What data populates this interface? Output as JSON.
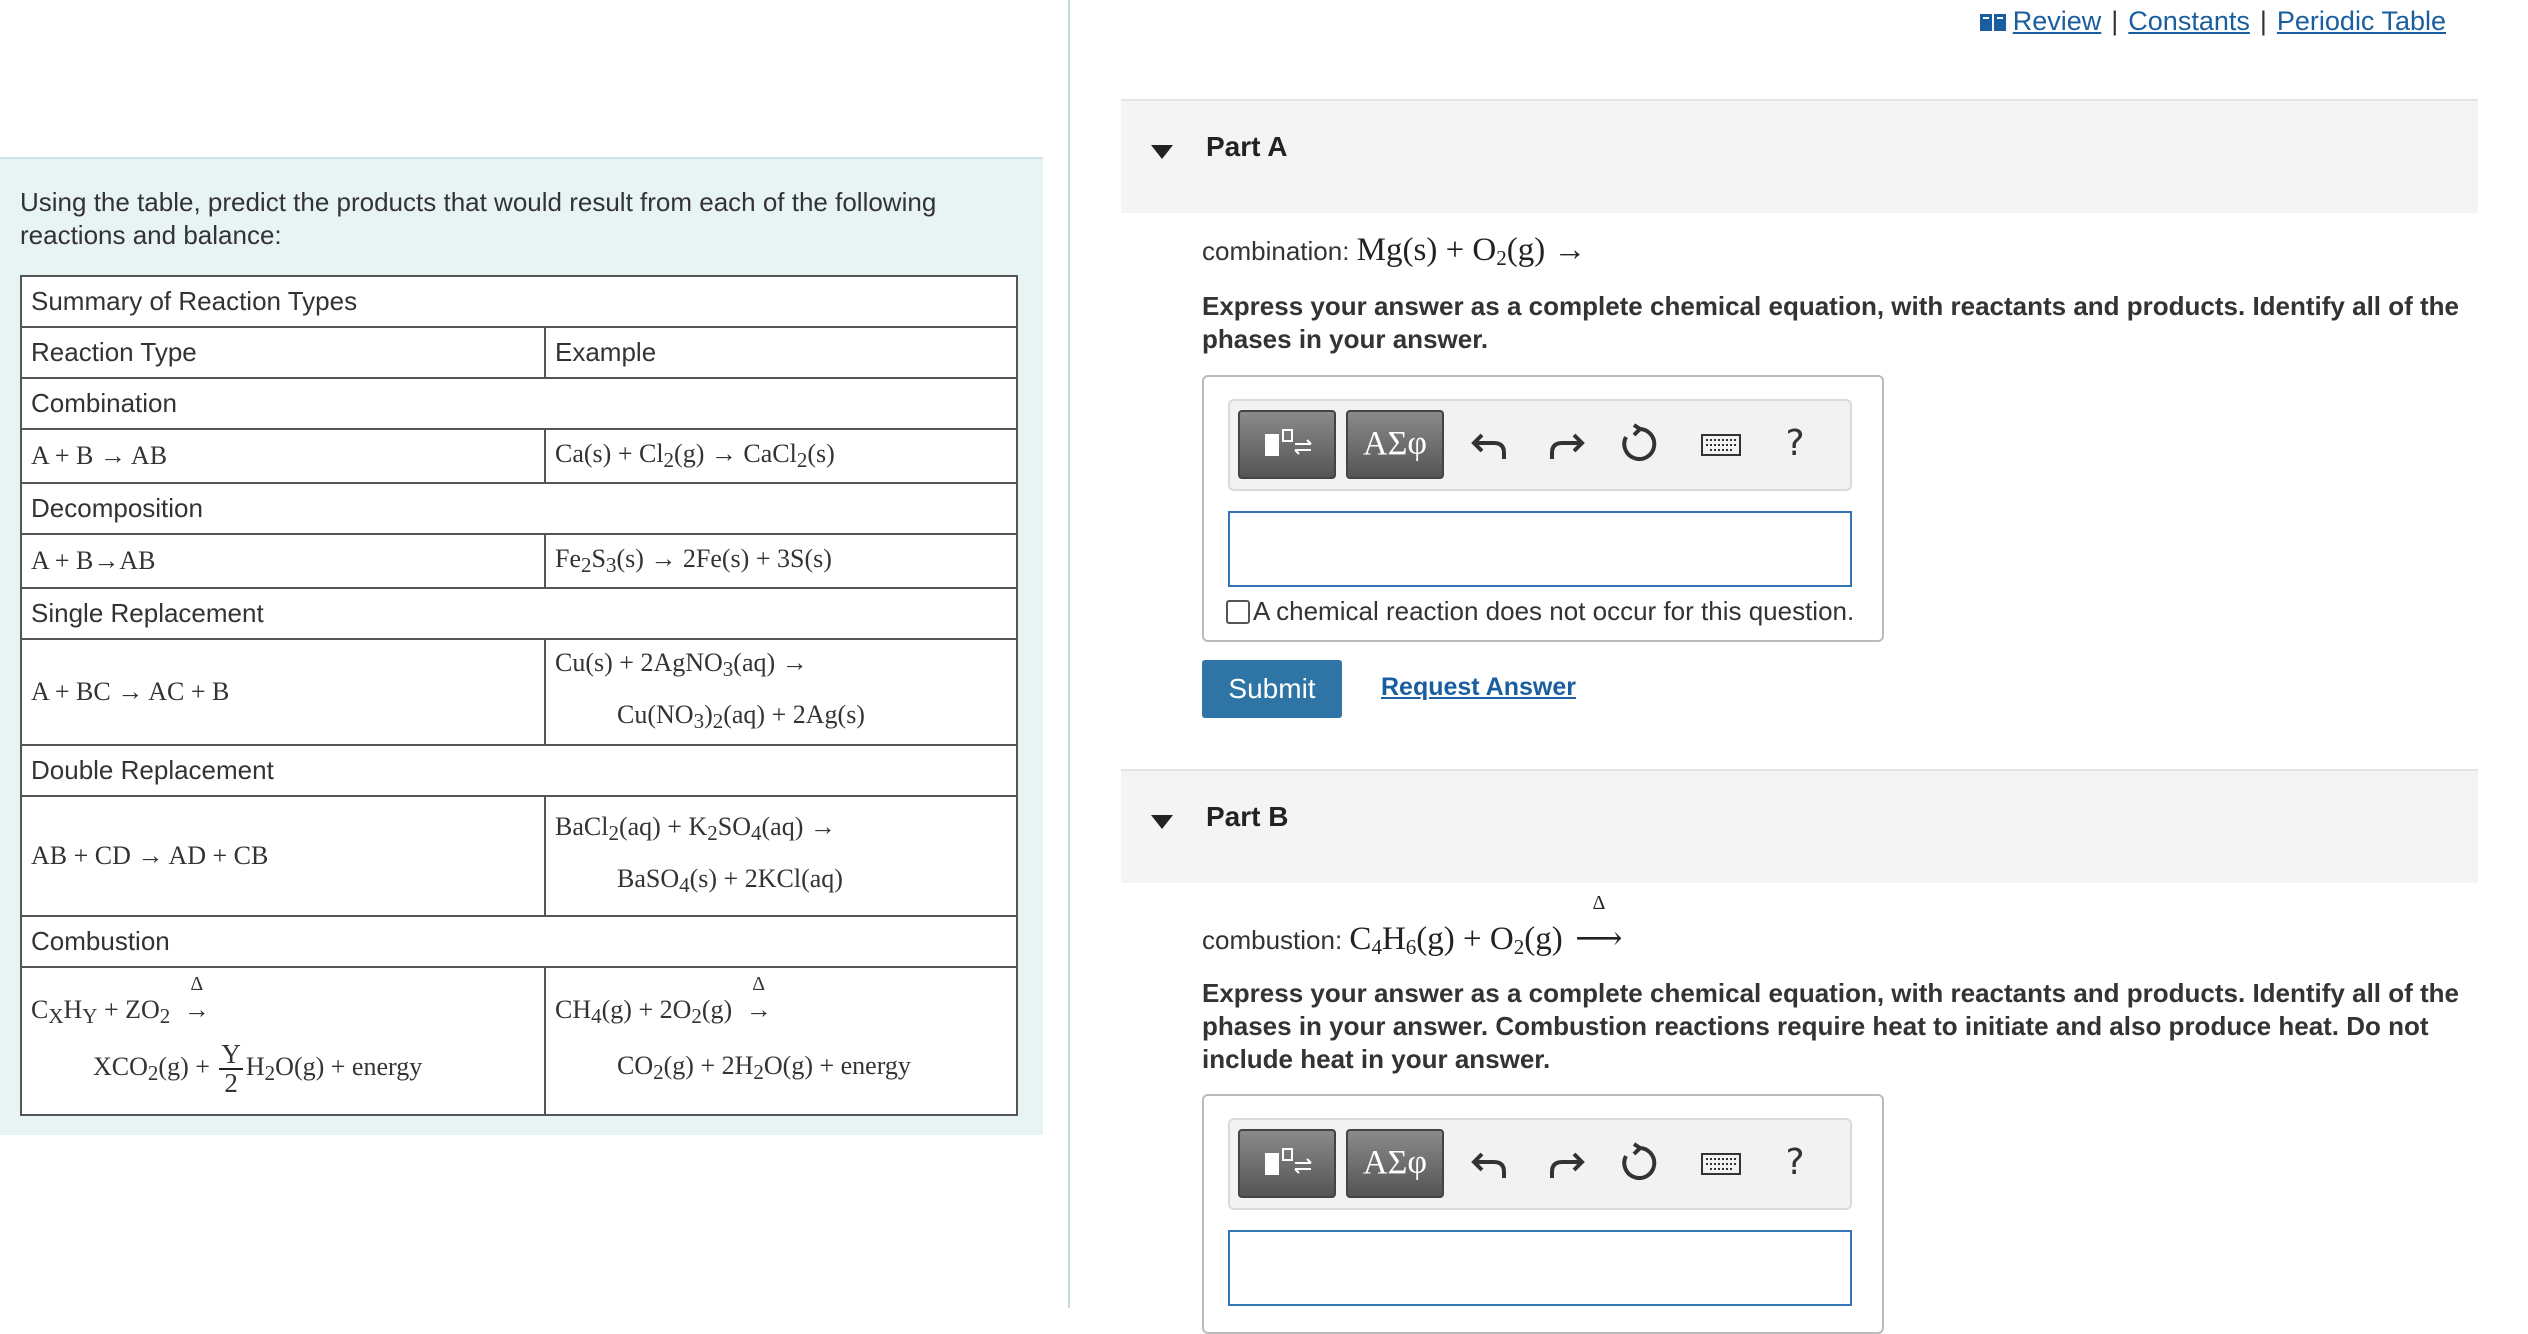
{
  "intro": {
    "text": "Using the table, predict the products that would result from each of the following reactions and balance:"
  },
  "table": {
    "caption": "Summary of Reaction Types",
    "col_reaction_type": "Reaction Type",
    "col_example": "Example",
    "sections": [
      {
        "name": "Combination"
      },
      {
        "name": "Decomposition"
      },
      {
        "name": "Single Replacement"
      },
      {
        "name": "Double Replacement"
      },
      {
        "name": "Combustion"
      }
    ]
  },
  "top_links": {
    "review": "Review",
    "constants": "Constants",
    "periodic_table": "Periodic Table",
    "separator": "|"
  },
  "part_a": {
    "title": "Part A",
    "question_prefix": "combination:",
    "instructions": "Express your answer as a complete chemical equation, with reactants and products. Identify all of the phases in your answer.",
    "no_reaction_label": "A chemical reaction does not occur for this question.",
    "submit_label": "Submit",
    "request_answer_label": "Request Answer",
    "answer_value": ""
  },
  "part_b": {
    "title": "Part B",
    "question_prefix": "combustion:",
    "instructions": "Express your answer as a complete chemical equation, with reactants and products. Identify all of the phases in your answer. Combustion reactions require heat to initiate and also produce heat. Do not include heat in your answer.",
    "answer_value": ""
  },
  "toolbar": {
    "greek_label": "ΑΣφ",
    "help_label": "?"
  },
  "colors": {
    "panel_bg": "#e8f4f4",
    "link": "#1a5ea0",
    "submit_bg": "#2e74a4",
    "input_border": "#3575b5"
  },
  "icons": [
    "book-icon",
    "templates-icon",
    "undo-icon",
    "redo-icon",
    "reset-icon",
    "keyboard-icon",
    "help-icon",
    "collapse-triangle-icon"
  ]
}
